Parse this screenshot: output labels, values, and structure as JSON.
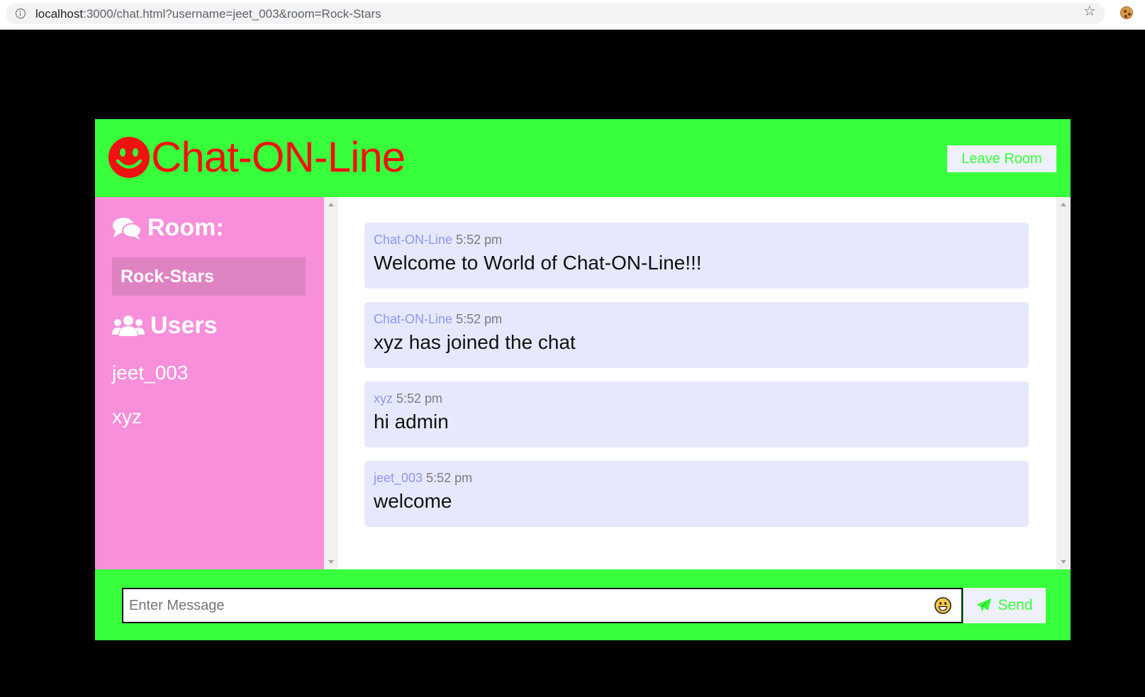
{
  "browser": {
    "url_host": "localhost",
    "url_rest": ":3000/chat.html?username=jeet_003&room=Rock-Stars"
  },
  "header": {
    "title": "Chat-ON-Line",
    "leave_label": "Leave Room"
  },
  "sidebar": {
    "room_heading": "Room:",
    "room_name": "Rock-Stars",
    "users_heading": "Users",
    "users": [
      "jeet_003",
      "xyz"
    ]
  },
  "messages": [
    {
      "author": "Chat-ON-Line",
      "time": "5:52 pm",
      "text": "Welcome to World of Chat-ON-Line!!!"
    },
    {
      "author": "Chat-ON-Line",
      "time": "5:52 pm",
      "text": "xyz has joined the chat"
    },
    {
      "author": "xyz",
      "time": "5:52 pm",
      "text": "hi admin"
    },
    {
      "author": "jeet_003",
      "time": "5:52 pm",
      "text": "welcome"
    }
  ],
  "form": {
    "placeholder": "Enter Message",
    "send_label": "Send"
  },
  "colors": {
    "header_green": "#38ff3c",
    "title_red": "#f21010",
    "sidebar_pink": "#f78fda",
    "message_bg": "#e6e9fd",
    "author_blue": "#8d97f0"
  },
  "icons": {
    "brand": "smile-icon",
    "room": "comments-icon",
    "users": "users-icon",
    "send": "paper-plane-icon",
    "emoji": "emoji-icon",
    "bookmark": "star-icon",
    "extension": "cookie-icon",
    "site_info": "info-icon"
  }
}
